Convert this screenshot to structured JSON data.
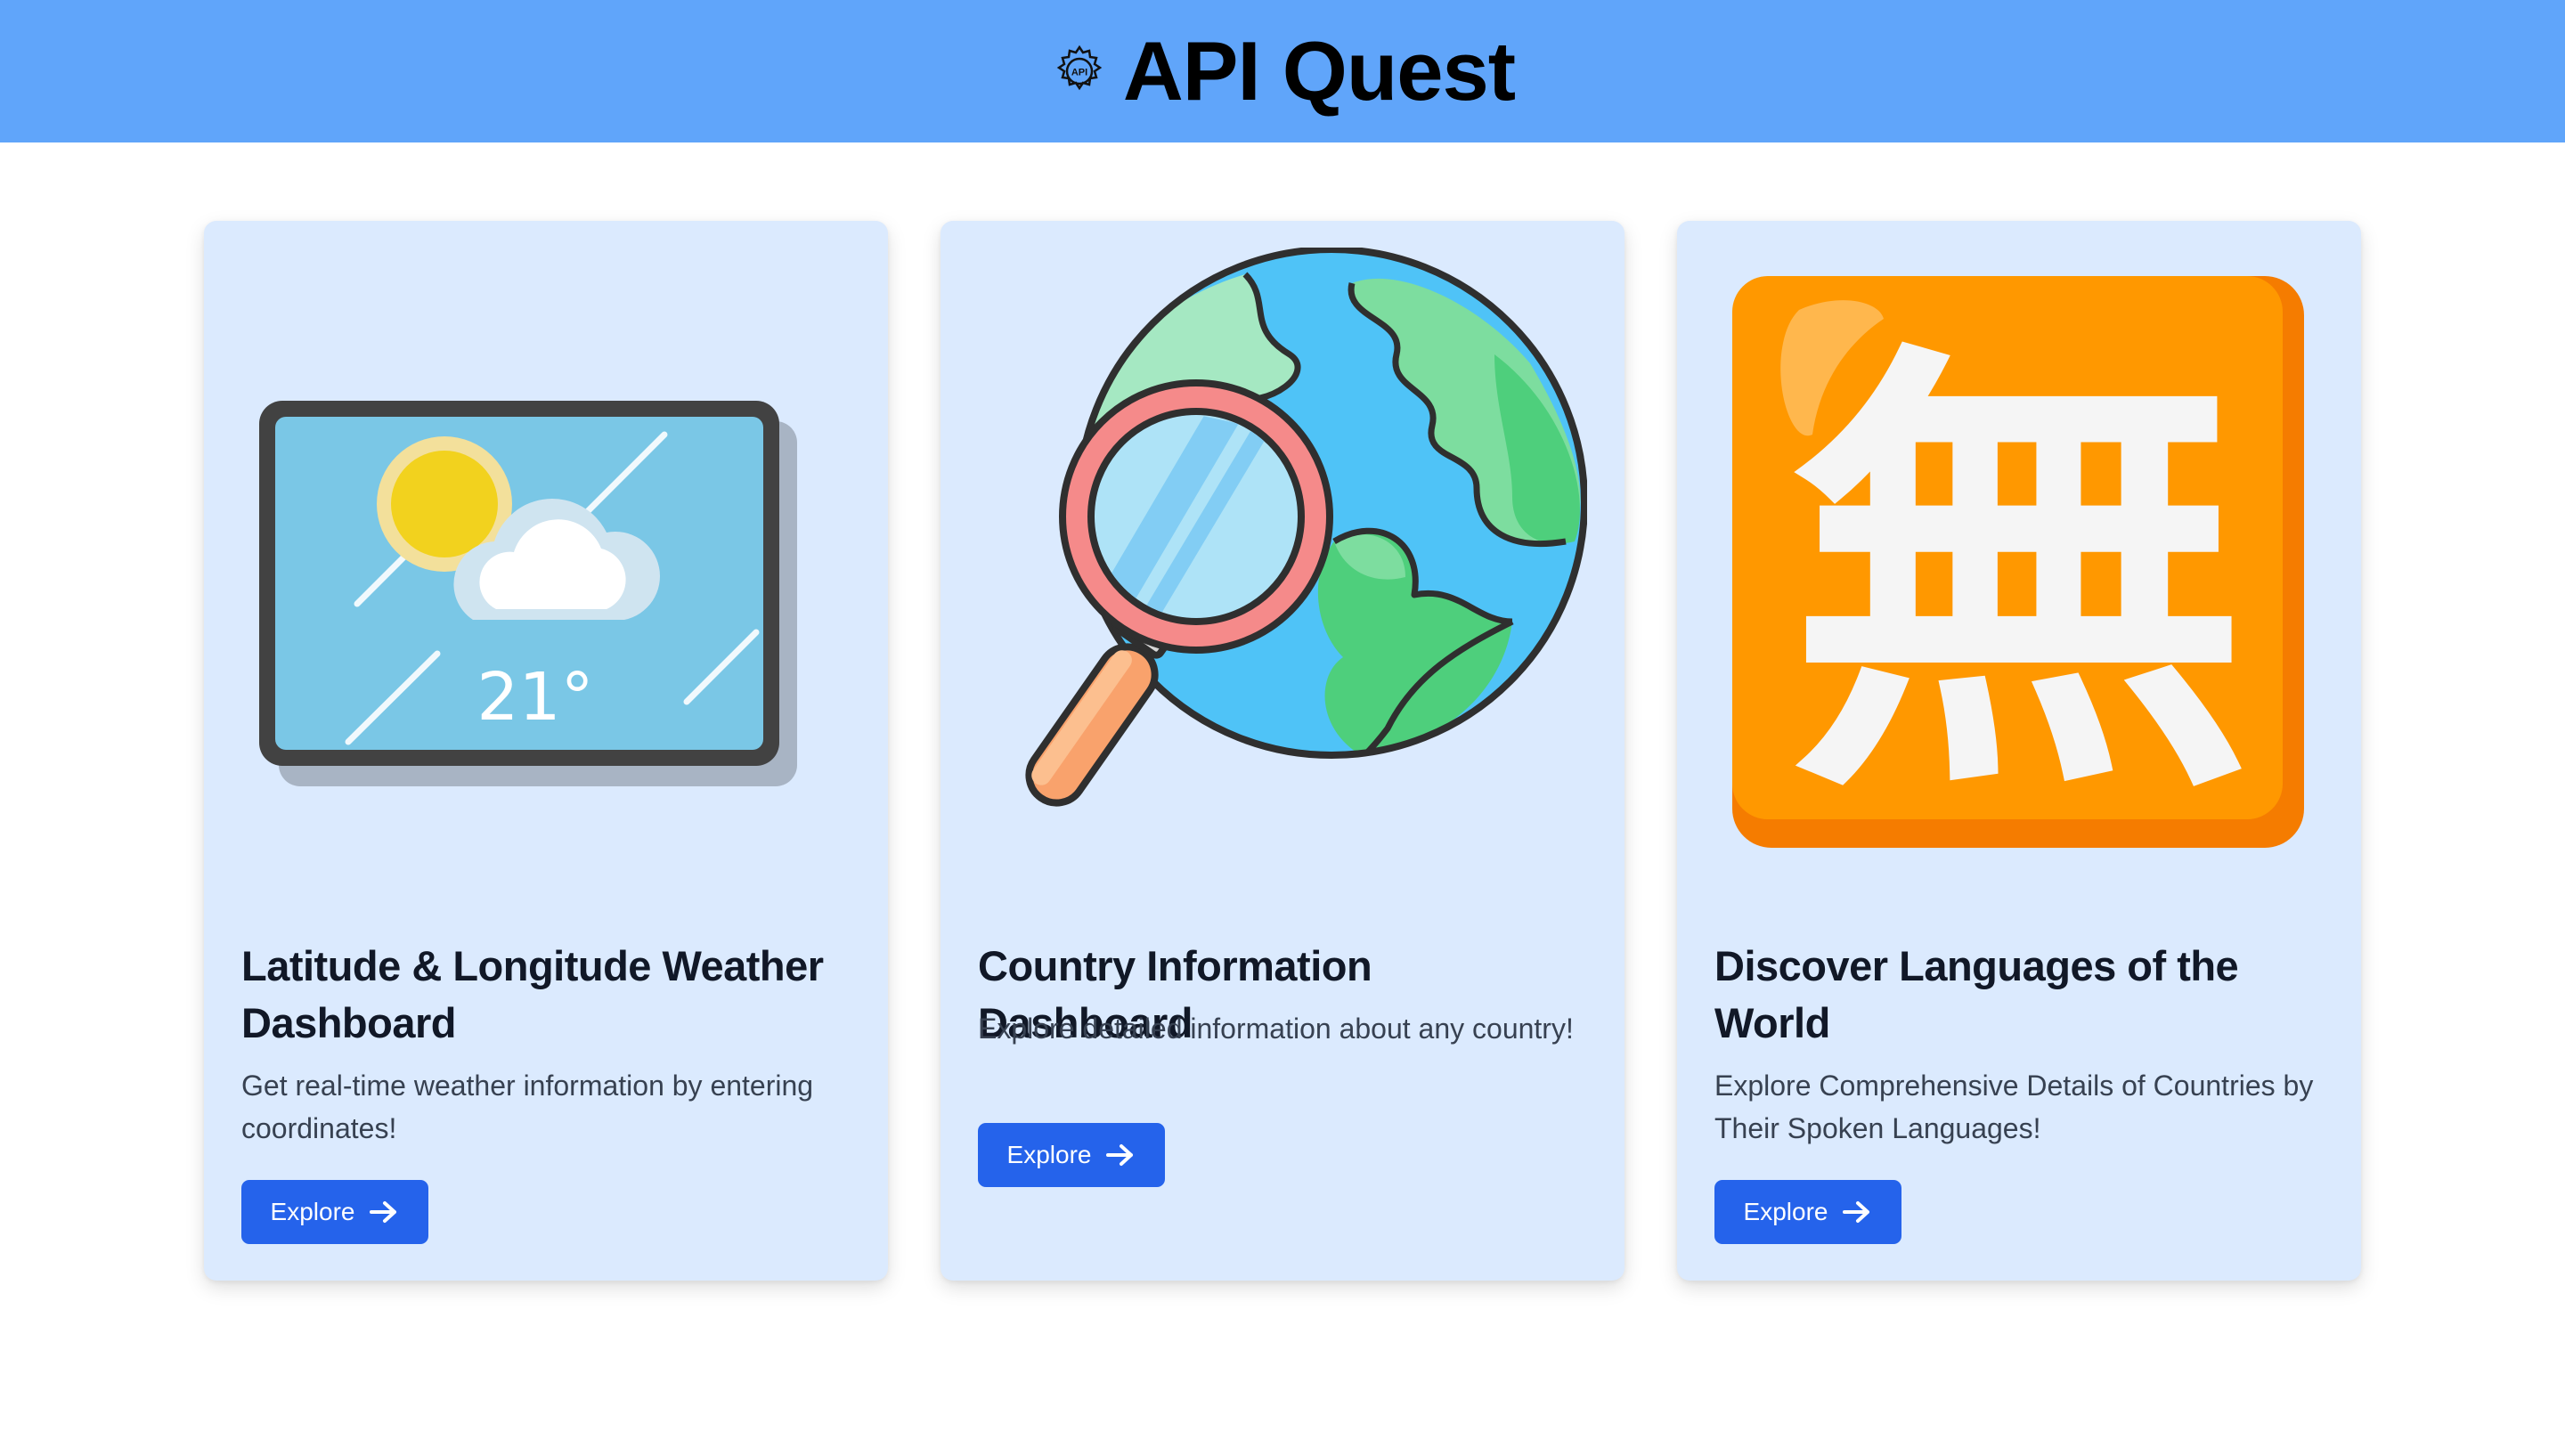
{
  "app": {
    "title": "API Quest",
    "logo_icon": "gear-api-icon",
    "logo_text": "API"
  },
  "colors": {
    "header_bg": "#60a5fa",
    "card_bg": "#dbeafe",
    "button_bg": "#2563eb",
    "title_text": "#111827",
    "body_text": "#374151"
  },
  "cards": [
    {
      "illustration": "weather-tablet-icon",
      "illustration_text": "21°",
      "title": "Latitude & Longitude Weather Dashboard",
      "description": "Get real-time weather information by entering coordinates!",
      "button_label": "Explore",
      "button_icon": "arrow-right-icon"
    },
    {
      "illustration": "globe-magnifier-icon",
      "title": "Country Information Dashboard",
      "description": "Explore detailed information about any country!",
      "button_label": "Explore",
      "button_icon": "arrow-right-icon"
    },
    {
      "illustration": "kanji-mu-icon",
      "illustration_text": "無",
      "title": "Discover Languages of the World",
      "description": "Explore Comprehensive Details of Countries by Their Spoken Languages!",
      "button_label": "Explore",
      "button_icon": "arrow-right-icon"
    }
  ]
}
